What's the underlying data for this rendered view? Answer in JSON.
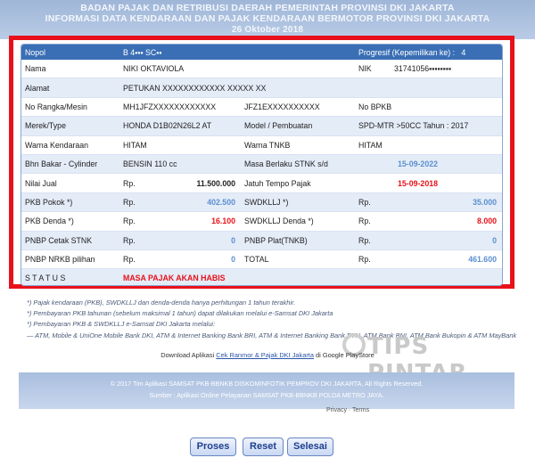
{
  "header": {
    "line1": "BADAN PAJAK DAN RETRIBUSI DAERAH PEMERINTAH PROVINSI DKI JAKARTA",
    "line2": "INFORMASI DATA KENDARAAN DAN PAJAK KENDARAAN BERMOTOR PROVINSI DKI JAKARTA",
    "date": "26 Oktober 2018"
  },
  "colors": {
    "highlight_border": "#e8111a",
    "table_header": "#3a6fb5",
    "value_blue": "#5b8fd0",
    "value_red": "#e8111a"
  },
  "table": {
    "head": {
      "nopol_label": "Nopol",
      "nopol_value": "B 4▪▪▪ SC▪▪",
      "progresif_label": "Progresif (Kepemilikan ke) :",
      "progresif_value": "4"
    },
    "nama": {
      "label": "Nama",
      "value": "NIKI OKTAVIOLA",
      "nik_label": "NIK",
      "nik_value": "31741056▪▪▪▪▪▪▪▪"
    },
    "alamat": {
      "label": "Alamat",
      "value": "PETUKAN XXXXXXXXXXXX XXXXX XX"
    },
    "rangka": {
      "label": "No Rangka/Mesin",
      "rangka_value": "MH1JFZXXXXXXXXXXXX",
      "mesin_value": "JFZ1EXXXXXXXXXX",
      "bpkb_label": "No BPKB"
    },
    "merek": {
      "label": "Merek/Type",
      "value": "HONDA   D1B02N26L2 AT",
      "model_label": "Model / Pembuatan",
      "model_value": "SPD-MTR >50CC  Tahun : 2017"
    },
    "warna": {
      "label": "Warna Kendaraan",
      "value": "HITAM",
      "tnkb_label": "Warna TNKB",
      "tnkb_value": "HITAM"
    },
    "bbm": {
      "label": "Bhn Bakar - Cylinder",
      "value": "BENSIN   110 cc",
      "stnk_label": "Masa Berlaku STNK s/d",
      "stnk_value": "15-09-2022"
    },
    "njual": {
      "label": "Nilai Jual",
      "cur": "Rp.",
      "value": "11.500.000",
      "jt_label": "Jatuh Tempo Pajak",
      "jt_value": "15-09-2018"
    },
    "pkb_pokok": {
      "label": "PKB Pokok *)",
      "cur": "Rp.",
      "value": "402.500",
      "sw_label": "SWDKLLJ *)",
      "sw_cur": "Rp.",
      "sw_value": "35.000"
    },
    "pkb_denda": {
      "label": "PKB Denda *)",
      "cur": "Rp.",
      "value": "16.100",
      "sw_label": "SWDKLLJ Denda *)",
      "sw_cur": "Rp.",
      "sw_value": "8.000"
    },
    "pnbp_stnk": {
      "label": "PNBP Cetak STNK",
      "cur": "Rp.",
      "value": "0",
      "plat_label": "PNBP Plat(TNKB)",
      "plat_cur": "Rp.",
      "plat_value": "0"
    },
    "pnbp_nrkb": {
      "label": "PNBP NRKB pilihan",
      "cur": "Rp.",
      "value": "0",
      "total_label": "TOTAL",
      "total_cur": "Rp.",
      "total_value": "461.600"
    },
    "status": {
      "label": "S T A T U S",
      "value": "MASA PAJAK AKAN HABIS"
    }
  },
  "notes": [
    "*) Pajak kendaraan (PKB), SWDKLLJ dan denda-denda hanya perhitungan 1 tahun terakhir.",
    "*) Pembayaran PKB tahunan (sebelum maksimal 1 tahun) dapat dilakukan melalui e-Samsat DKI Jakarta",
    "*) Pembayaran PKB & SWDKLLJ e-Samsat DKI Jakarta melalui:",
    "— ATM, Mobile & UniOne Mobile Bank DKI, ATM & Internet Banking Bank BRI, ATM & Internet Banking Bank BTN, ATM Bank BNI, ATM Bank Bukopin & ATM MayBank"
  ],
  "download": {
    "prefix": "Download Aplikasi",
    "link": "Cek Ranmor & Pajak DKI Jakarta",
    "suffix": "di Google PlayStore"
  },
  "footer": {
    "line1": "© 2017 Tim Aplikasi SAMSAT PKB-BBNKB DISKOMINFOTIK PEMPROV DKI JAKARTA, All Rights Reserved.",
    "line2": "Sumber : Aplikasi Online Pelayanan SAMSAT PKB-BBNKB POLDA METRO JAYA."
  },
  "privacy": "Privacy · Terms",
  "watermark": "TIPS PINTAR",
  "buttons": {
    "proses": "Proses",
    "reset": "Reset",
    "selesai": "Selesai"
  }
}
